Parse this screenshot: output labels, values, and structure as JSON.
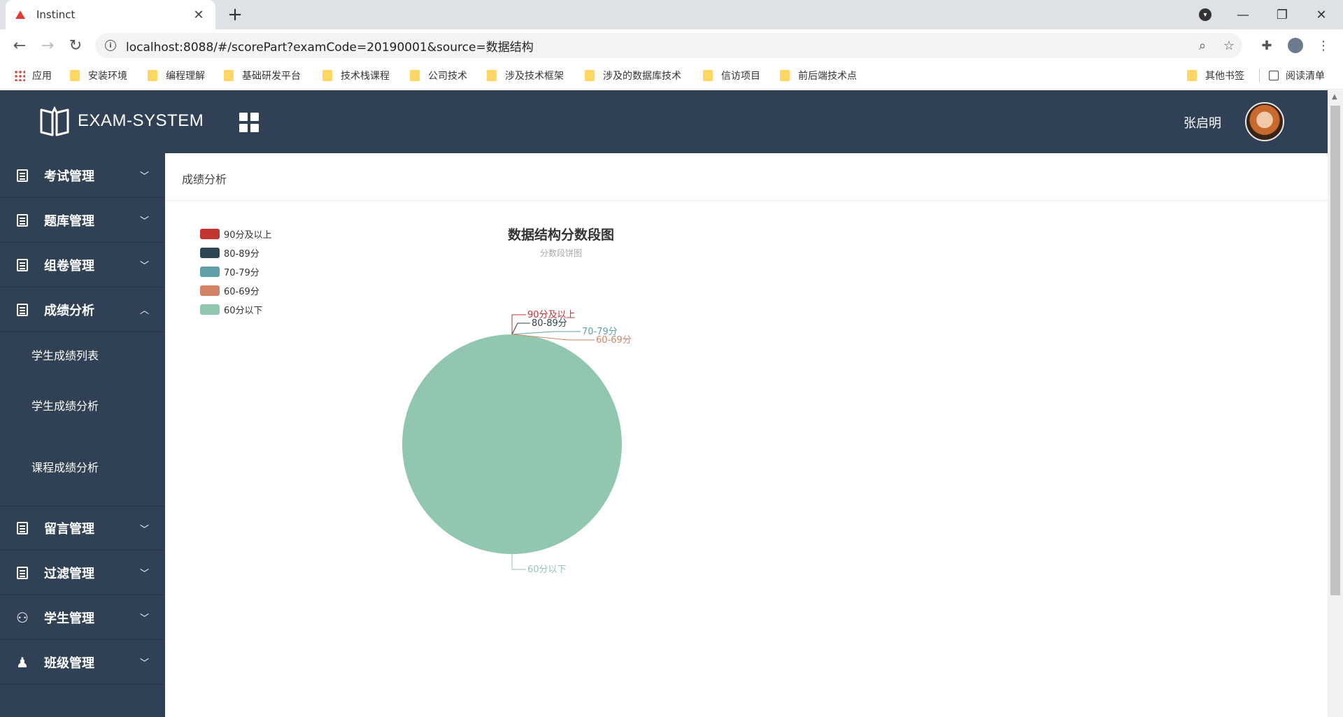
{
  "browser": {
    "tab_title": "Instinct",
    "url": "localhost:8088/#/scorePart?examCode=20190001&source=数据结构",
    "bookmarks": [
      "应用",
      "安装环境",
      "编程理解",
      "基础研发平台",
      "技术栈课程",
      "公司技术",
      "涉及技术框架",
      "涉及的数据库技术",
      "信访项目",
      "前后端技术点"
    ],
    "bookmarks_right": [
      "其他书签",
      "阅读清单"
    ]
  },
  "header": {
    "logo_text": "EXAM-SYSTEM",
    "user_name": "张启明"
  },
  "sidebar": {
    "items": [
      {
        "label": "考试管理",
        "icon": "exam-list-icon",
        "expanded": false
      },
      {
        "label": "题库管理",
        "icon": "question-bank-icon",
        "expanded": false
      },
      {
        "label": "组卷管理",
        "icon": "paper-compose-icon",
        "expanded": false
      },
      {
        "label": "成绩分析",
        "icon": "score-analysis-icon",
        "expanded": true
      },
      {
        "label": "留言管理",
        "icon": "message-icon",
        "expanded": false
      },
      {
        "label": "过滤管理",
        "icon": "filter-icon",
        "expanded": false
      },
      {
        "label": "学生管理",
        "icon": "student-icon",
        "expanded": false
      },
      {
        "label": "班级管理",
        "icon": "class-icon",
        "expanded": false
      }
    ],
    "sub_items": [
      "学生成绩列表",
      "学生成绩分析",
      "课程成绩分析"
    ]
  },
  "breadcrumb": "成绩分析",
  "chart_data": {
    "type": "pie",
    "title": "数据结构分数段图",
    "subtitle": "分数段饼图",
    "legend_position": "top-left",
    "categories": [
      "90分及以上",
      "80-89分",
      "70-79分",
      "60-69分",
      "60分以下"
    ],
    "values": [
      0,
      0,
      0,
      0,
      1
    ],
    "colors": [
      "#c23531",
      "#2f4554",
      "#61a0a8",
      "#d48265",
      "#91c7ae"
    ]
  }
}
